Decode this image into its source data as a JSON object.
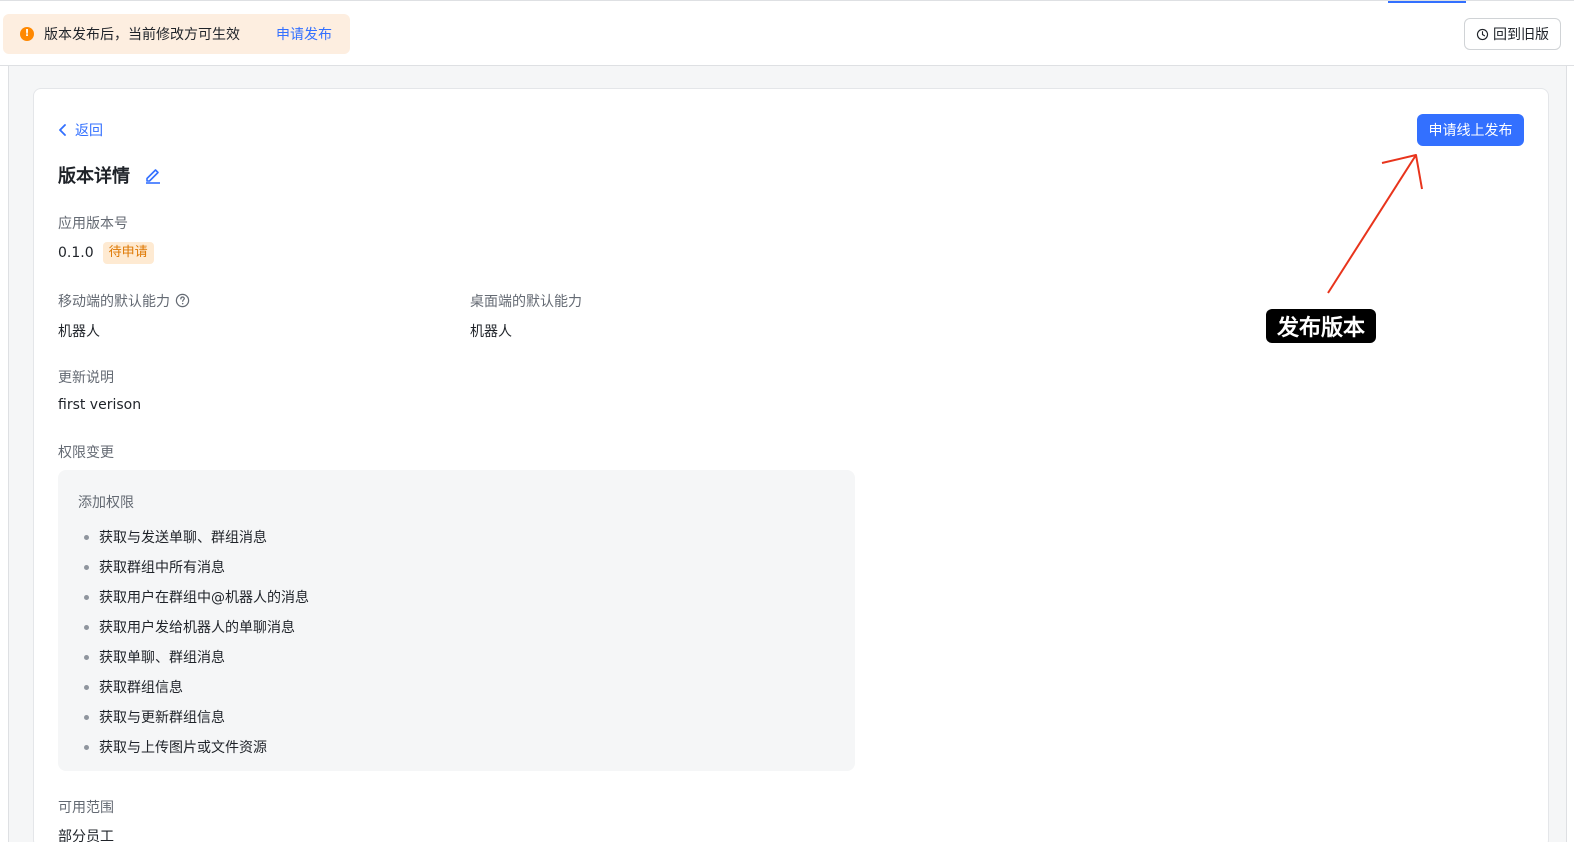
{
  "topbar": {
    "notice_text": "版本发布后，当前修改方可生效",
    "notice_link": "申请发布",
    "old_version_button": "回到旧版"
  },
  "header": {
    "back_label": "返回",
    "publish_button": "申请线上发布",
    "title": "版本详情"
  },
  "version": {
    "label": "应用版本号",
    "number": "0.1.0",
    "status": "待申请"
  },
  "capabilities": {
    "mobile_label": "移动端的默认能力",
    "mobile_value": "机器人",
    "desktop_label": "桌面端的默认能力",
    "desktop_value": "机器人"
  },
  "update_notes": {
    "label": "更新说明",
    "value": "first verison"
  },
  "permissions": {
    "label": "权限变更",
    "added_label": "添加权限",
    "items": [
      "获取与发送单聊、群组消息",
      "获取群组中所有消息",
      "获取用户在群组中@机器人的消息",
      "获取用户发给机器人的单聊消息",
      "获取单聊、群组消息",
      "获取群组信息",
      "获取与更新群组信息",
      "获取与上传图片或文件资源"
    ]
  },
  "scope": {
    "label": "可用范围",
    "value": "部分员工"
  },
  "annotation": {
    "label": "发布版本",
    "arrow_color": "#e8341c"
  },
  "colors": {
    "accent": "#3370ff",
    "warning": "#ff8800",
    "status_tag_bg": "#feead2",
    "status_tag_text": "#de7802"
  }
}
